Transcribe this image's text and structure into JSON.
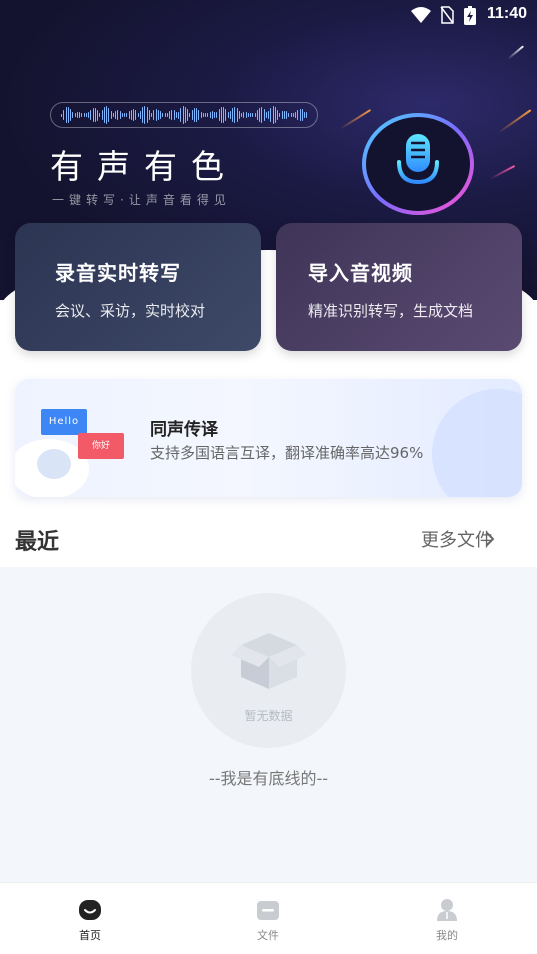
{
  "status_bar": {
    "time": "11:40"
  },
  "hero": {
    "title": "有声有色",
    "subtitle": "一键转写·让声音看得见"
  },
  "feature_cards": [
    {
      "title": "录音实时转写",
      "desc": "会议、采访，实时校对"
    },
    {
      "title": "导入音视频",
      "desc": "精准识别转写，生成文档"
    }
  ],
  "translate_banner": {
    "hello": "Hello",
    "nihao": "你好",
    "title": "同声传译",
    "desc": "支持多国语言互译，翻译准确率高达96%"
  },
  "recent": {
    "title": "最近",
    "more": "更多文件",
    "empty": "暂无数据",
    "bottom_line": "--我是有底线的--"
  },
  "tabs": [
    {
      "label": "首页",
      "active": true
    },
    {
      "label": "文件",
      "active": false
    },
    {
      "label": "我的",
      "active": false
    }
  ],
  "colors": {
    "hero_bg": "#1b1a44",
    "accent_blue": "#3d86f5",
    "accent_red": "#f25a68"
  }
}
